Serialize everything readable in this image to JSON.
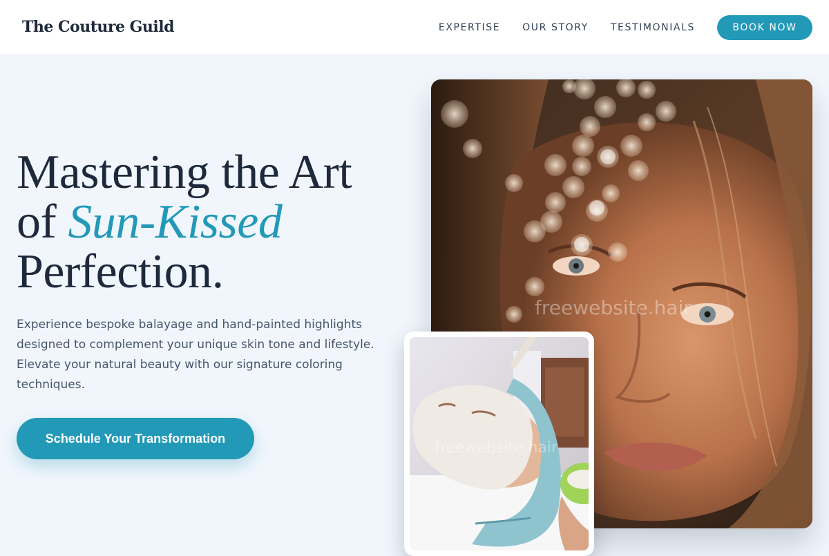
{
  "header": {
    "logo": "The Couture Guild",
    "nav": [
      "EXPERTISE",
      "OUR STORY",
      "TESTIMONIALS"
    ],
    "cta": "BOOK NOW"
  },
  "hero": {
    "title_line1": "Mastering the Art",
    "title_of": "of",
    "title_accent": "Sun-Kissed",
    "title_line3": "Perfection.",
    "description": "Experience bespoke balayage and hand-painted highlights designed to complement your unique skin tone and lifestyle. Elevate your natural beauty with our signature coloring techniques.",
    "cta": "Schedule Your Transformation"
  },
  "images": {
    "main_watermark": "freewebsite.hair",
    "inset_watermark": "freewebsite.hair"
  },
  "colors": {
    "accent": "#2399b8",
    "heading": "#1e293b",
    "body_text": "#475569",
    "background": "#f0f6fc"
  }
}
